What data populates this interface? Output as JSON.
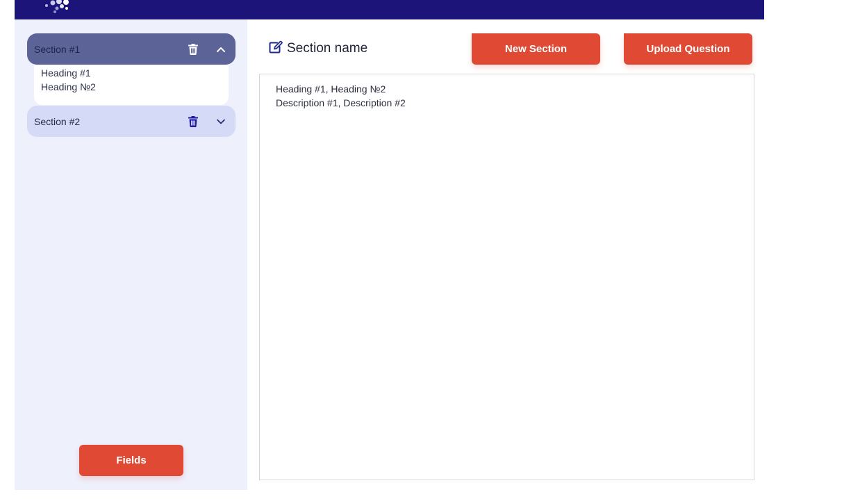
{
  "header": {
    "brand_color": "#1c1479",
    "logo_icon": "dots-logo-icon"
  },
  "sidebar": {
    "sections": [
      {
        "label": "Section #1",
        "expanded": true,
        "delete_icon": "trash-icon",
        "toggle_icon": "chevron-up-icon",
        "items": [
          "Heading #1",
          "Heading №2"
        ]
      },
      {
        "label": "Section #2",
        "expanded": false,
        "delete_icon": "trash-icon",
        "toggle_icon": "chevron-down-icon",
        "items": []
      }
    ],
    "fields_button": "Fields"
  },
  "main": {
    "title": "Section name",
    "title_icon": "edit-icon",
    "new_section_button": "New Section",
    "upload_question_button": "Upload Question",
    "content_lines": [
      "Heading #1, Heading №2",
      "Description #1, Description #2"
    ]
  },
  "colors": {
    "accent": "#e04a35",
    "sidebar_bg": "#eef0fc",
    "active_section_bg": "#5c6396",
    "inactive_section_bg": "#d5dbf6",
    "trash_inactive": "#1f1aa0"
  }
}
